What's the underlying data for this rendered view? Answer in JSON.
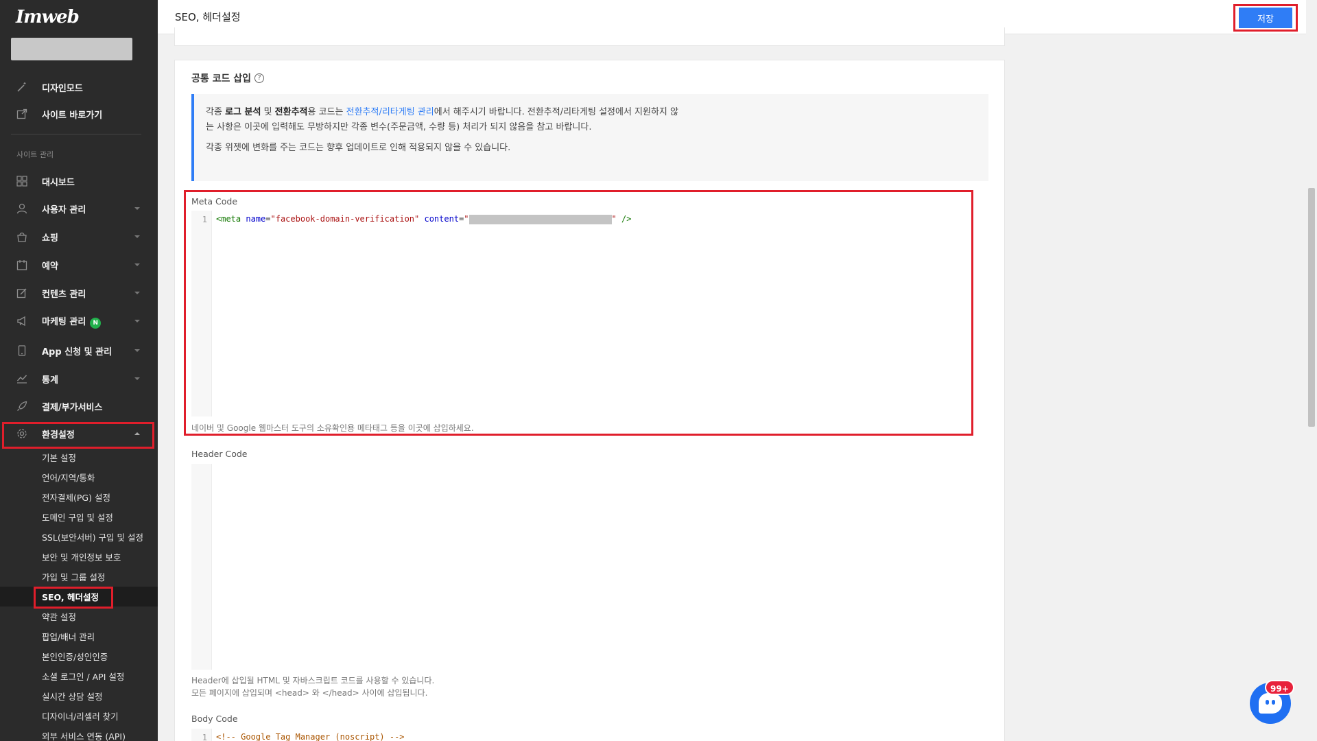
{
  "app": {
    "logo": "Imweb",
    "page_title": "SEO, 헤더설정",
    "save_label": "저장"
  },
  "sidebar": {
    "top_items": [
      {
        "label": "디자인모드",
        "icon": "wand-icon"
      },
      {
        "label": "사이트 바로가기",
        "icon": "external-link-icon"
      }
    ],
    "section_label": "사이트 관리",
    "menu": [
      {
        "label": "대시보드",
        "icon": "grid-icon",
        "caret": false
      },
      {
        "label": "사용자 관리",
        "icon": "user-icon",
        "caret": true
      },
      {
        "label": "쇼핑",
        "icon": "bag-icon",
        "caret": true
      },
      {
        "label": "예약",
        "icon": "calendar-icon",
        "caret": true
      },
      {
        "label": "컨텐츠 관리",
        "icon": "edit-icon",
        "caret": true
      },
      {
        "label": "마케팅 관리",
        "icon": "megaphone-icon",
        "caret": true,
        "badge": "N"
      },
      {
        "label": "App 신청 및 관리",
        "icon": "mobile-icon",
        "caret": true
      },
      {
        "label": "통계",
        "icon": "chart-icon",
        "caret": true
      },
      {
        "label": "결제/부가서비스",
        "icon": "rocket-icon",
        "caret": false
      },
      {
        "label": "환경설정",
        "icon": "gear-icon",
        "caret": true,
        "expanded": true
      }
    ],
    "sub_items": [
      "기본 설정",
      "언어/지역/통화",
      "전자결제(PG) 설정",
      "도메인 구입 및 설정",
      "SSL(보안서버) 구입 및 설정",
      "보안 및 개인정보 보호",
      "가입 및 그룹 설정",
      "SEO, 헤더설정",
      "약관 설정",
      "팝업/배너 관리",
      "본인인증/성인인증",
      "소셜 로그인 / API 설정",
      "실시간 상담 설정",
      "디자이너/리셀러 찾기",
      "외부 서비스 연동 (API)"
    ],
    "active_sub_index": 7
  },
  "section": {
    "title": "공통 코드 삽입",
    "info": {
      "p1_a": "각종 ",
      "p1_b": "로그 분석",
      "p1_c": " 및 ",
      "p1_d": "전환추적",
      "p1_e": "용 코드는 ",
      "p1_link": "전환추적/리타게팅 관리",
      "p1_f": "에서 해주시기 바랍니다. 전환추적/리타게팅 설정에서 지원하지 않는 사항은 이곳에 입력해도 무방하지만 각종 변수(주문금액, 수량 등) 처리가 되지 않음을 참고 바랍니다.",
      "p2": "각종 위젯에 변화를 주는 코드는 향후 업데이트로 인해 적용되지 않을 수 있습니다."
    }
  },
  "meta_code": {
    "label": "Meta Code",
    "line_no": "1",
    "code_open": "<meta",
    "attr_name": "name",
    "eq1": "=",
    "val_name": "\"facebook-domain-verification\"",
    "attr_content": "content",
    "eq2": "=",
    "quote_open": "\"",
    "quote_close": "\"",
    "code_close": "/>",
    "hint": "네이버 및 Google 웹마스터 도구의 소유확인용 메타태그 등을 이곳에 삽입하세요."
  },
  "header_code": {
    "label": "Header Code",
    "hint1": "Header에 삽입될 HTML 및 자바스크립트 코드를 사용할 수 있습니다.",
    "hint2": "모든 페이지에 삽입되며 <head> 와 </head> 사이에 삽입됩니다."
  },
  "body_code": {
    "label": "Body Code",
    "line_no": "1",
    "code": "<!-- Google Tag Manager (noscript) -->"
  },
  "chat": {
    "badge": "99+"
  },
  "colors": {
    "sidebar_bg": "#2b2b2b",
    "accent": "#2f7df6",
    "highlight_red": "#e01e2b"
  }
}
